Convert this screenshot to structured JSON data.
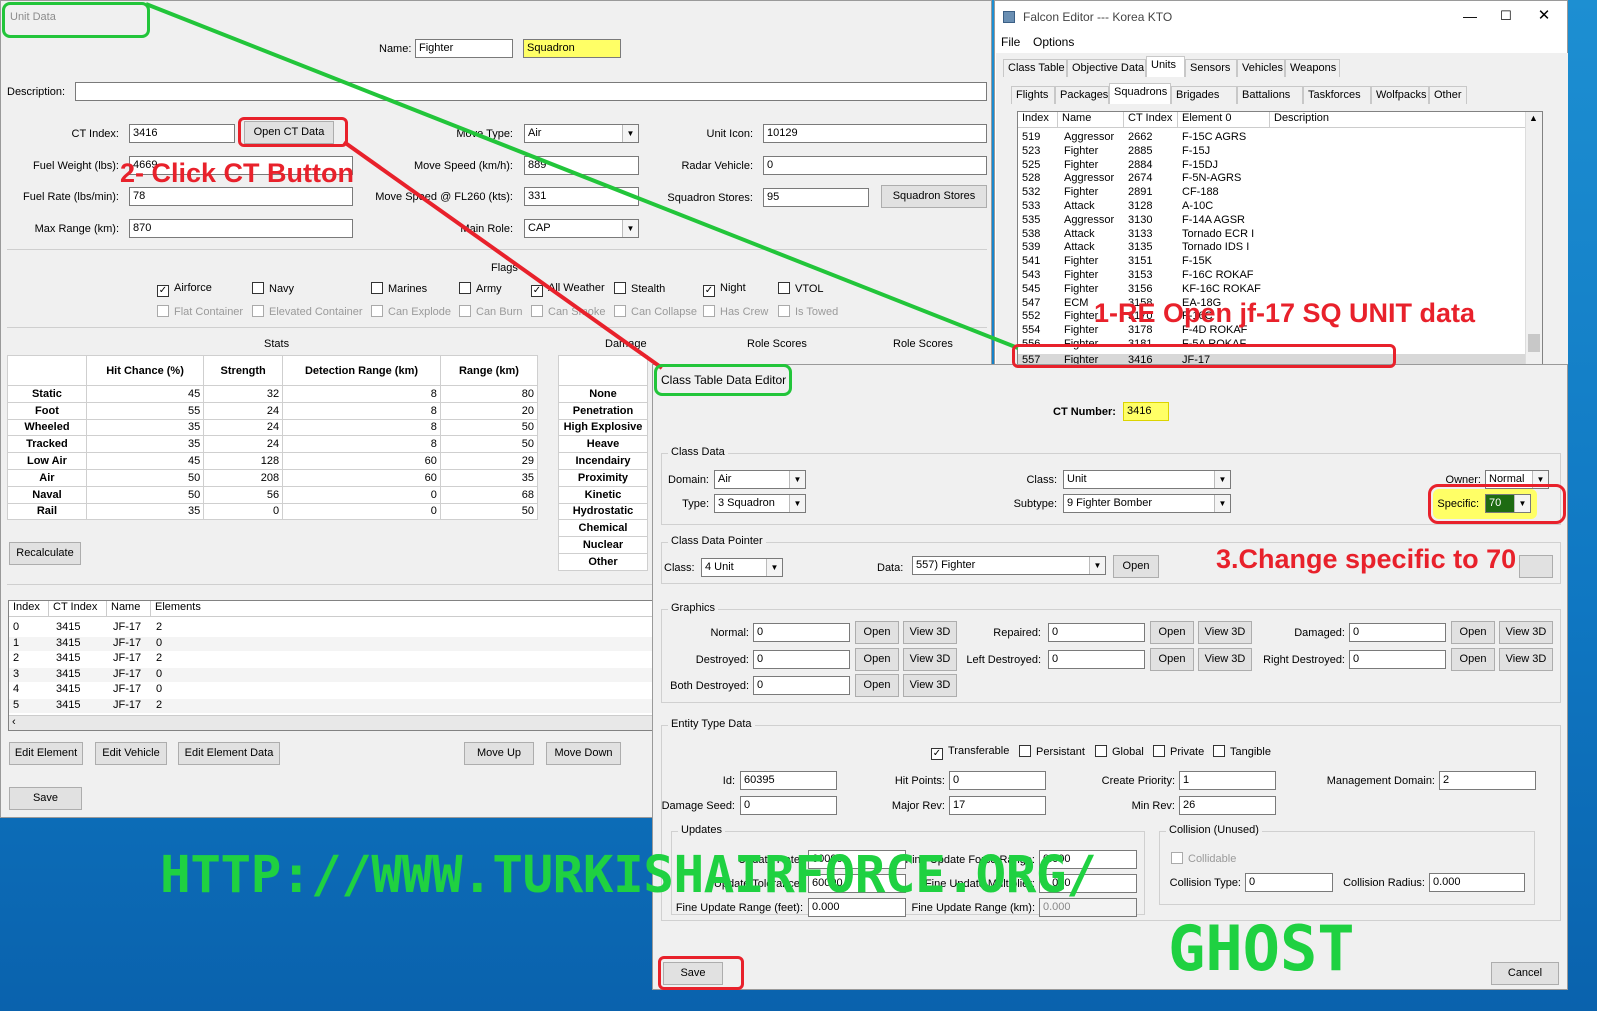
{
  "unit_window": {
    "title": "Unit Data",
    "name_label": "Name:",
    "name_value": "Fighter",
    "name2_value": "Squadron",
    "description_label": "Description:",
    "ct_index_label": "CT Index:",
    "ct_index_value": "3416",
    "open_ct_button": "Open CT Data",
    "fuel_weight_label": "Fuel Weight (lbs):",
    "fuel_weight_value": "4669",
    "fuel_rate_label": "Fuel Rate (lbs/min):",
    "fuel_rate_value": "78",
    "max_range_label": "Max Range (km):",
    "max_range_value": "870",
    "move_type_label": "Move Type:",
    "move_type_value": "Air",
    "move_speed_label": "Move Speed (km/h):",
    "move_speed_value": "889",
    "move_speed_fl_label": "Move Speed @ FL260 (kts):",
    "move_speed_fl_value": "331",
    "main_role_label": "Main Role:",
    "main_role_value": "CAP",
    "unit_icon_label": "Unit Icon:",
    "unit_icon_value": "10129",
    "radar_vehicle_label": "Radar Vehicle:",
    "radar_vehicle_value": "0",
    "squadron_stores_label": "Squadron Stores:",
    "squadron_stores_value": "95",
    "squadron_stores_button": "Squadron Stores",
    "flags_title": "Flags",
    "flags_row1": [
      {
        "label": "Airforce",
        "checked": true
      },
      {
        "label": "Navy",
        "checked": false
      },
      {
        "label": "Marines",
        "checked": false
      },
      {
        "label": "Army",
        "checked": false
      },
      {
        "label": "All Weather",
        "checked": true
      },
      {
        "label": "Stealth",
        "checked": false
      },
      {
        "label": "Night",
        "checked": true
      },
      {
        "label": "VTOL",
        "checked": false
      }
    ],
    "flags_row2": [
      "Flat Container",
      "Elevated Container",
      "Can Explode",
      "Can Burn",
      "Can Smoke",
      "Can Collapse",
      "Has Crew",
      "Is Towed"
    ],
    "stats_title": "Stats",
    "damage_title": "Damage",
    "role_scores_title": "Role Scores",
    "role_scores_title2": "Role Scores",
    "stats_headers": [
      "Hit Chance (%)",
      "Strength",
      "Detection Range (km)",
      "Range (km)"
    ],
    "stats_rows": [
      {
        "name": "Static",
        "values": [
          "45",
          "32",
          "8",
          "80"
        ]
      },
      {
        "name": "Foot",
        "values": [
          "55",
          "24",
          "8",
          "20"
        ]
      },
      {
        "name": "Wheeled",
        "values": [
          "35",
          "24",
          "8",
          "50"
        ]
      },
      {
        "name": "Tracked",
        "values": [
          "35",
          "24",
          "8",
          "50"
        ]
      },
      {
        "name": "Low Air",
        "values": [
          "45",
          "128",
          "60",
          "29"
        ]
      },
      {
        "name": "Air",
        "values": [
          "50",
          "208",
          "60",
          "35"
        ]
      },
      {
        "name": "Naval",
        "values": [
          "50",
          "56",
          "0",
          "68"
        ]
      },
      {
        "name": "Rail",
        "values": [
          "35",
          "0",
          "0",
          "50"
        ]
      }
    ],
    "damage_rows": [
      "None",
      "Penetration",
      "High Explosive",
      "Heave",
      "Incendairy",
      "Proximity",
      "Kinetic",
      "Hydrostatic",
      "Chemical",
      "Nuclear",
      "Other"
    ],
    "recalculate_button": "Recalculate",
    "elements_headers": [
      "Index",
      "CT Index",
      "Name",
      "Elements"
    ],
    "elements_rows": [
      [
        "0",
        "3415",
        "JF-17",
        "2"
      ],
      [
        "1",
        "3415",
        "JF-17",
        "0"
      ],
      [
        "2",
        "3415",
        "JF-17",
        "2"
      ],
      [
        "3",
        "3415",
        "JF-17",
        "0"
      ],
      [
        "4",
        "3415",
        "JF-17",
        "0"
      ],
      [
        "5",
        "3415",
        "JF-17",
        "2"
      ]
    ],
    "edit_element_button": "Edit Element",
    "edit_vehicle_button": "Edit Vehicle",
    "edit_element_data_button": "Edit Element Data",
    "move_up_button": "Move Up",
    "move_down_button": "Move Down",
    "save_button": "Save"
  },
  "falcon_window": {
    "title": "Falcon Editor --- Korea KTO",
    "menu": [
      "File",
      "Options"
    ],
    "tabs1": [
      "Class Table",
      "Objective Data",
      "Units",
      "Sensors",
      "Vehicles",
      "Weapons"
    ],
    "tabs2": [
      "Flights",
      "Packages",
      "Squadrons",
      "Brigades",
      "Battalions",
      "Taskforces",
      "Wolfpacks",
      "Other"
    ],
    "list_headers": [
      "Index",
      "Name",
      "CT Index",
      "Element 0",
      "Description"
    ],
    "rows": [
      [
        "519",
        "Aggressor",
        "2662",
        "F-15C AGRS"
      ],
      [
        "523",
        "Fighter",
        "2885",
        "F-15J"
      ],
      [
        "525",
        "Fighter",
        "2884",
        "F-15DJ"
      ],
      [
        "528",
        "Aggressor",
        "2674",
        "F-5N-AGRS"
      ],
      [
        "532",
        "Fighter",
        "2891",
        "CF-188"
      ],
      [
        "533",
        "Attack",
        "3128",
        "A-10C"
      ],
      [
        "535",
        "Aggressor",
        "3130",
        "F-14A AGSR"
      ],
      [
        "538",
        "Attack",
        "3133",
        "Tornado ECR I"
      ],
      [
        "539",
        "Attack",
        "3135",
        "Tornado IDS I"
      ],
      [
        "541",
        "Fighter",
        "3151",
        "F-15K"
      ],
      [
        "543",
        "Fighter",
        "3153",
        "F-16C ROKAF"
      ],
      [
        "545",
        "Fighter",
        "3156",
        "KF-16C ROKAF"
      ],
      [
        "547",
        "ECM",
        "3158",
        "EA-18G"
      ],
      [
        "552",
        "Fighter",
        "3170",
        "F-16C"
      ],
      [
        "554",
        "Fighter",
        "3178",
        "F-4D ROKAF"
      ],
      [
        "556",
        "Fighter",
        "3181",
        "F-5A ROKAF"
      ],
      [
        "557",
        "Fighter",
        "3416",
        "JF-17"
      ]
    ]
  },
  "ct_window": {
    "title": "Class Table Data Editor",
    "ct_number_label": "CT Number:",
    "ct_number_value": "3416",
    "class_data_title": "Class Data",
    "domain_label": "Domain:",
    "domain_value": "Air",
    "type_label": "Type:",
    "type_value": "3 Squadron",
    "class_label": "Class:",
    "class_value": "Unit",
    "subtype_label": "Subtype:",
    "subtype_value": "9 Fighter Bomber",
    "owner_label": "Owner:",
    "owner_value": "Normal",
    "specific_label": "Specific:",
    "specific_value": "70",
    "pointer_title": "Class Data Pointer",
    "ptr_class_label": "Class:",
    "ptr_class_value": "4 Unit",
    "ptr_data_label": "Data:",
    "ptr_data_value": "557) Fighter",
    "open_label": "Open",
    "view3d_label": "View 3D",
    "graphics_title": "Graphics",
    "normal_label": "Normal:",
    "repaired_label": "Repaired:",
    "damaged_label": "Damaged:",
    "destroyed_label": "Destroyed:",
    "left_destroyed_label": "Left Destroyed:",
    "right_destroyed_label": "Right Destroyed:",
    "both_destroyed_label": "Both Destroyed:",
    "zero": "0",
    "entity_title": "Entity Type Data",
    "entity_flags": [
      {
        "label": "Transferable",
        "checked": true
      },
      {
        "label": "Persistant",
        "checked": false
      },
      {
        "label": "Global",
        "checked": false
      },
      {
        "label": "Private",
        "checked": false
      },
      {
        "label": "Tangible",
        "checked": false
      }
    ],
    "id_label": "Id:",
    "id_value": "60395",
    "hit_points_label": "Hit Points:",
    "hit_points_value": "0",
    "create_priority_label": "Create Priority:",
    "create_priority_value": "1",
    "mgmt_domain_label": "Management Domain:",
    "mgmt_domain_value": "2",
    "damage_seed_label": "Damage Seed:",
    "damage_seed_value": "0",
    "major_rev_label": "Major Rev:",
    "major_rev_value": "17",
    "min_rev_label": "Min Rev:",
    "min_rev_value": "26",
    "updates_title": "Updates",
    "update_rate_label": "Update Rate:",
    "update_rate_value": "60000",
    "update_tolerance_label": "Update Tolerance:",
    "update_tolerance_value": "60000",
    "fine_feet_label": "Fine Update Range (feet):",
    "fine_feet_value": "0.000",
    "fine_force_label": "Fine Update Force Range:",
    "fine_force_value": "0.000",
    "fine_mult_label": "Fine Update Multiplier:",
    "fine_mult_value": "1.000",
    "fine_km_label": "Fine Update Range (km):",
    "fine_km_value": "0.000",
    "collision_title": "Collision (Unused)",
    "collidable_label": "Collidable",
    "collision_type_label": "Collision Type:",
    "collision_type_value": "0",
    "collision_radius_label": "Collision Radius:",
    "collision_radius_value": "0.000",
    "save_button": "Save",
    "cancel_button": "Cancel"
  },
  "annotations": {
    "step1": "1-RE Open jf-17 SQ UNIT data",
    "step2": "2- Click CT Button",
    "step3": "3.Change specific to 70",
    "watermark1": "HTTP://WWW.TURKISHAIRFORCE.ORG/",
    "watermark2": "GHOST"
  },
  "colors": {
    "highlight_yellow": "#ffff66",
    "annotation_red": "#e8212b",
    "annotation_green": "#22c53a",
    "selection": "#0078d7"
  }
}
